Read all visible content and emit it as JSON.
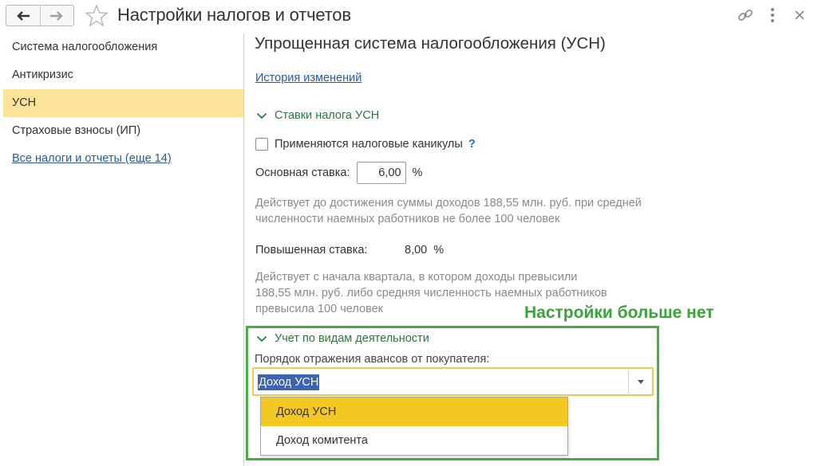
{
  "window": {
    "title": "Настройки налогов и отчетов"
  },
  "sidebar": {
    "items": [
      {
        "label": "Система налогообложения",
        "active": false
      },
      {
        "label": "Антикризис",
        "active": false
      },
      {
        "label": "УСН",
        "active": true
      },
      {
        "label": "Страховые взносы (ИП)",
        "active": false
      }
    ],
    "all_taxes_link": "Все налоги и отчеты (еще 14)"
  },
  "main": {
    "section_title": "Упрощенная система налогообложения (УСН)",
    "history_link": "История изменений",
    "rates_group": {
      "title": "Ставки налога УСН",
      "tax_holidays_label": "Применяются налоговые каникулы",
      "tax_holidays_checked": false,
      "help": "?",
      "base_rate_label": "Основная ставка:",
      "base_rate_value": "6,00",
      "percent": "%",
      "base_note": [
        "Действует до достижения суммы доходов 188,55 млн. руб. при средней",
        "численности наемных работников не более 100 человек"
      ],
      "raised_rate_label": "Повышенная ставка:",
      "raised_rate_value": "8,00  %",
      "raised_note": [
        "Действует с начала квартала, в котором доходы превысили",
        "188,55 млн. руб. либо средняя численность наемных работников",
        "превысила 100 человек"
      ]
    },
    "activity_group": {
      "title": "Учет по видам деятельности",
      "order_label": "Порядок отражения авансов от покупателя:",
      "selected_value": "Доход УСН",
      "options": [
        "Доход УСН",
        "Доход комитента"
      ]
    }
  },
  "annotation": {
    "text": "Настройки больше нет"
  },
  "colors": {
    "accent_green": "#3aa33a",
    "sidebar_active": "#fbe49a",
    "dropdown_selected": "#f4c823",
    "link": "#2a58a8"
  }
}
